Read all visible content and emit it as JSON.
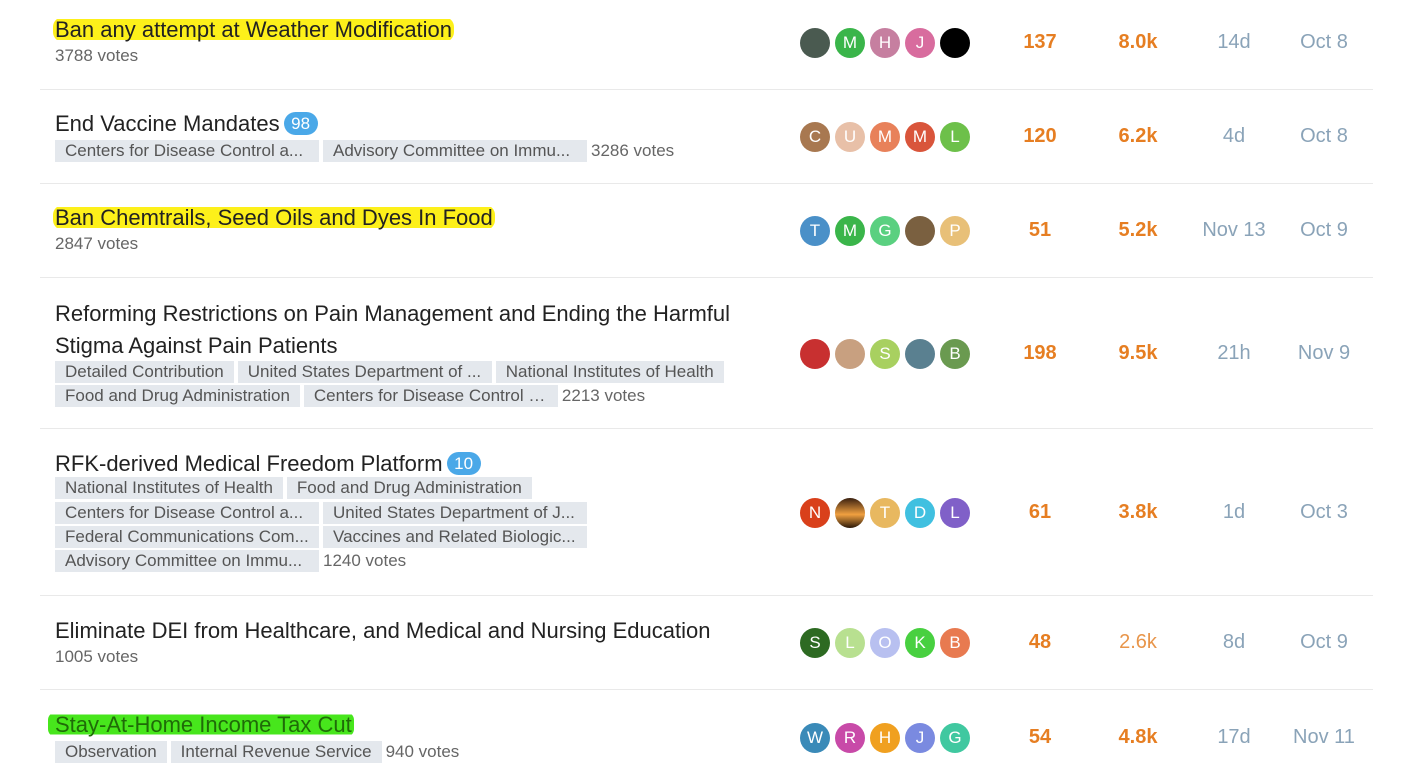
{
  "topics": [
    {
      "title": "Ban any attempt at Weather Modification",
      "highlight": "yellow",
      "badge": null,
      "tags": [],
      "votes": "3788 votes",
      "posters": [
        {
          "letter": "",
          "color": "#4a5a50",
          "icon": "user-photo-icon"
        },
        {
          "letter": "M",
          "color": "#3ab54a"
        },
        {
          "letter": "H",
          "color": "#c67fa0"
        },
        {
          "letter": "J",
          "color": "#d86c9e"
        },
        {
          "letter": "",
          "color": "#000000",
          "icon": "user-photo-icon"
        }
      ],
      "replies": "137",
      "views": "8.0k",
      "activity": "14d",
      "created": "Oct 8"
    },
    {
      "title": "End Vaccine Mandates",
      "badge": "98",
      "tags": [
        "Centers for Disease Control a...",
        "Advisory Committee on Immu..."
      ],
      "votes": "3286 votes",
      "posters": [
        {
          "letter": "C",
          "color": "#a87850"
        },
        {
          "letter": "U",
          "color": "#e8c0a8"
        },
        {
          "letter": "M",
          "color": "#e8815a"
        },
        {
          "letter": "M",
          "color": "#d9553b"
        },
        {
          "letter": "L",
          "color": "#6dc04a"
        }
      ],
      "replies": "120",
      "views": "6.2k",
      "activity": "4d",
      "created": "Oct 8"
    },
    {
      "title": "Ban Chemtrails, Seed Oils and Dyes In Food",
      "highlight": "yellow",
      "badge": null,
      "tags": [],
      "votes": "2847 votes",
      "posters": [
        {
          "letter": "T",
          "color": "#4a90c8"
        },
        {
          "letter": "M",
          "color": "#3ab54a"
        },
        {
          "letter": "G",
          "color": "#5ad080"
        },
        {
          "letter": "",
          "color": "#7a6040",
          "icon": "user-photo-icon"
        },
        {
          "letter": "P",
          "color": "#e8c078"
        }
      ],
      "replies": "51",
      "views": "5.2k",
      "activity": "Nov 13",
      "created": "Oct 9"
    },
    {
      "title": "Reforming Restrictions on Pain Management and Ending the Harmful Stigma Against Pain Patients",
      "badge": null,
      "tags": [
        "Detailed Contribution",
        "United States Department of ...",
        "National Institutes of Health",
        "Food and Drug Administration",
        "Centers for Disease Control a..."
      ],
      "votes": "2213 votes",
      "posters": [
        {
          "letter": "",
          "color": "#c83030",
          "icon": "user-photo-icon"
        },
        {
          "letter": "",
          "color": "#c8a080",
          "icon": "user-photo-icon"
        },
        {
          "letter": "S",
          "color": "#a8d060"
        },
        {
          "letter": "",
          "color": "#5a8090",
          "icon": "user-photo-icon"
        },
        {
          "letter": "B",
          "color": "#6a9a50"
        }
      ],
      "replies": "198",
      "views": "9.5k",
      "activity": "21h",
      "created": "Nov 9"
    },
    {
      "title": "RFK-derived Medical Freedom Platform",
      "badge": "10",
      "tags": [
        "National Institutes of Health",
        "Food and Drug Administration",
        "Centers for Disease Control a...",
        "United States Department of J...",
        "Federal Communications Com...",
        "Vaccines and Related Biologic...",
        "Advisory Committee on Immu..."
      ],
      "votes": "1240 votes",
      "posters": [
        {
          "letter": "N",
          "color": "#d9401b"
        },
        {
          "letter": "",
          "color": "#8a5020",
          "icon": "user-photo-icon"
        },
        {
          "letter": "T",
          "color": "#e8b860"
        },
        {
          "letter": "D",
          "color": "#40c0e0"
        },
        {
          "letter": "L",
          "color": "#8060c8"
        }
      ],
      "replies": "61",
      "views": "3.8k",
      "activity": "1d",
      "created": "Oct 3"
    },
    {
      "title": "Eliminate DEI from Healthcare, and Medical and Nursing Education",
      "badge": null,
      "tags": [],
      "votes": "1005 votes",
      "posters": [
        {
          "letter": "S",
          "color": "#2d6a22"
        },
        {
          "letter": "L",
          "color": "#b8e090"
        },
        {
          "letter": "O",
          "color": "#b8c0f0"
        },
        {
          "letter": "K",
          "color": "#48d040"
        },
        {
          "letter": "B",
          "color": "#e87a50"
        }
      ],
      "replies": "48",
      "views": "2.6k",
      "activity": "8d",
      "created": "Oct 9"
    },
    {
      "title": "Stay-At-Home Income Tax Cut",
      "highlight": "green",
      "badge": null,
      "tags": [
        "Observation",
        "Internal Revenue Service"
      ],
      "votes": "940 votes",
      "posters": [
        {
          "letter": "W",
          "color": "#3a8ab8"
        },
        {
          "letter": "R",
          "color": "#c84aa8"
        },
        {
          "letter": "H",
          "color": "#f0a020"
        },
        {
          "letter": "J",
          "color": "#7a8ae0"
        },
        {
          "letter": "G",
          "color": "#40c8a0"
        }
      ],
      "replies": "54",
      "views": "4.8k",
      "activity": "17d",
      "created": "Nov 11"
    }
  ]
}
